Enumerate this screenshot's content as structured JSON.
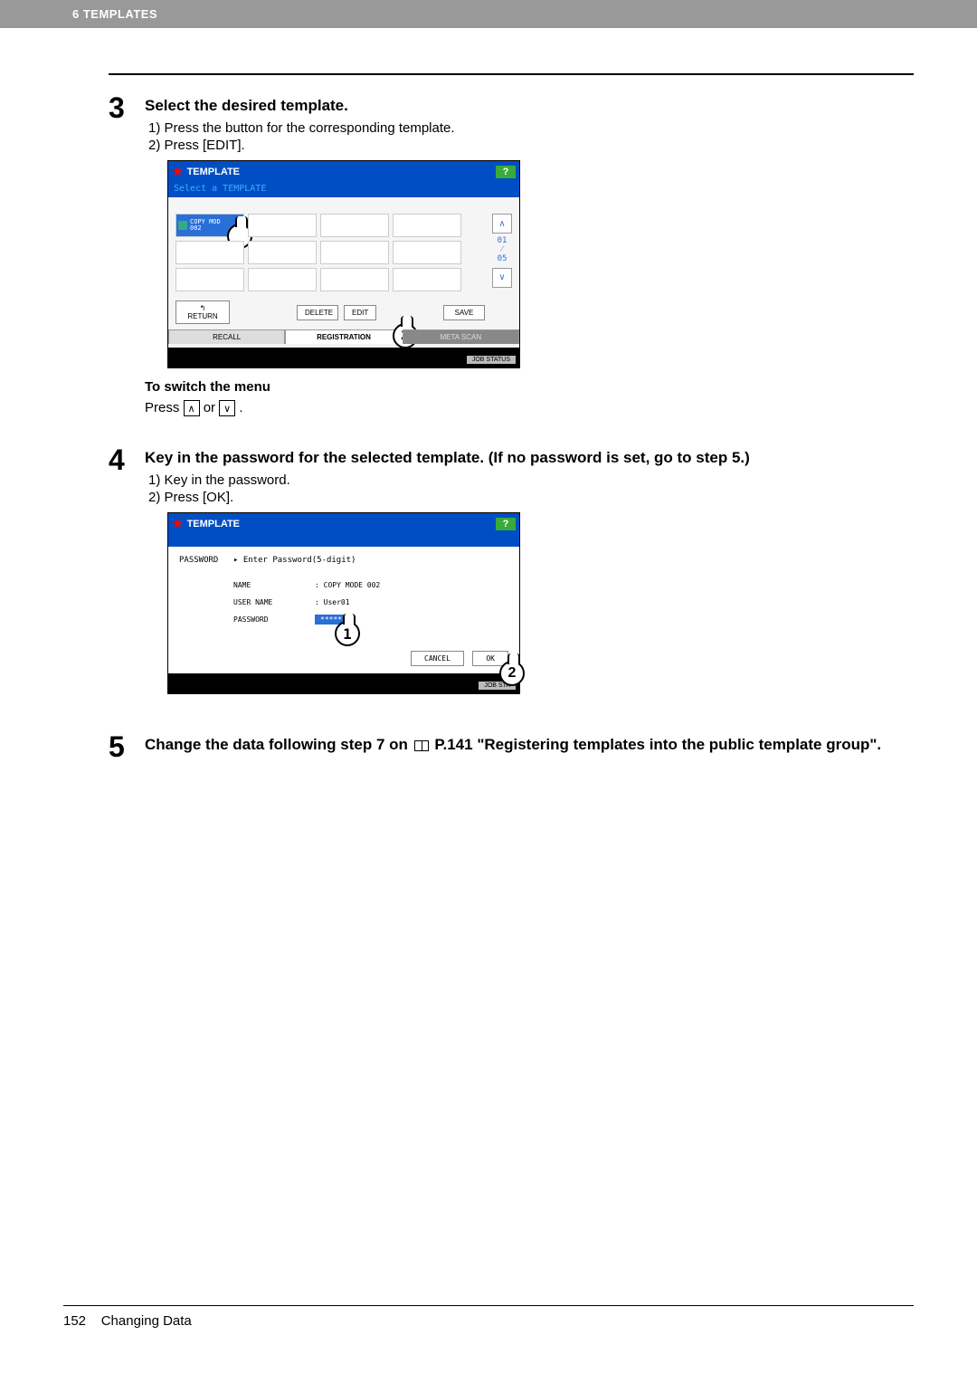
{
  "header": {
    "chapter": "6 TEMPLATES"
  },
  "step3": {
    "num": "3",
    "title": "Select the desired template.",
    "sub1": "1)  Press the button for the corresponding template.",
    "sub2": "2)  Press [EDIT].",
    "screen": {
      "title": "TEMPLATE",
      "help": "?",
      "subtitle": "Select a TEMPLATE",
      "cell_selected": "COPY MOD\n002",
      "page_top": "01",
      "page_bot": "05",
      "btn_return": "RETURN",
      "btn_delete": "DELETE",
      "btn_edit": "EDIT",
      "btn_save": "SAVE",
      "tab_recall": "RECALL",
      "tab_registration": "REGISTRATION",
      "tab_meta": "META SCAN",
      "job_status": "JOB STATUS"
    },
    "note_title": "To switch the menu",
    "note_body_prefix": "Press ",
    "note_body_mid": " or ",
    "note_body_suffix": " ."
  },
  "step4": {
    "num": "4",
    "title": "Key in the password for the selected template. (If no password is set, go to step 5.)",
    "sub1": "1)  Key in the password.",
    "sub2": "2)  Press [OK].",
    "screen": {
      "title": "TEMPLATE",
      "help": "?",
      "pw_label": "PASSWORD",
      "pw_hint": "▸ Enter Password(5-digit)",
      "name_k": "NAME",
      "name_v": ": COPY MODE 002",
      "user_k": "USER NAME",
      "user_v": ": User01",
      "pass_k": "PASSWORD",
      "pass_v": "*****",
      "btn_cancel": "CANCEL",
      "btn_ok": "OK",
      "job_status": "JOB STA"
    }
  },
  "step5": {
    "num": "5",
    "title_a": "Change the data following step 7 on ",
    "title_b": " P.141 \"Registering templates into the public template group\"."
  },
  "footer": {
    "page": "152",
    "section": "Changing Data"
  },
  "callouts": {
    "c1": "1",
    "c2": "2"
  }
}
